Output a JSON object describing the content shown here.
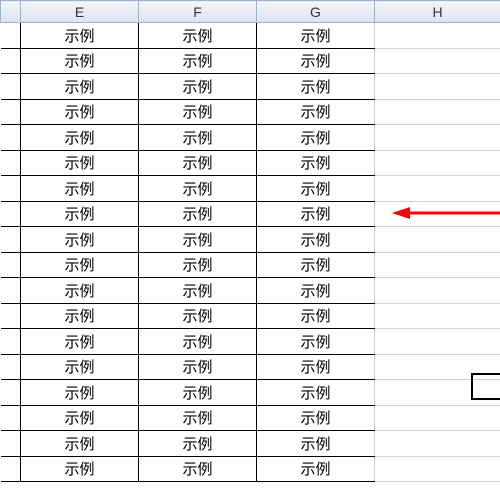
{
  "columns": [
    "E",
    "F",
    "G",
    "H"
  ],
  "cell_value": "示例",
  "rows": 18,
  "arrow_color": "#ff0000",
  "chart_data": {
    "type": "table",
    "columns": [
      "E",
      "F",
      "G",
      "H"
    ],
    "data": [
      [
        "示例",
        "示例",
        "示例",
        ""
      ],
      [
        "示例",
        "示例",
        "示例",
        ""
      ],
      [
        "示例",
        "示例",
        "示例",
        ""
      ],
      [
        "示例",
        "示例",
        "示例",
        ""
      ],
      [
        "示例",
        "示例",
        "示例",
        ""
      ],
      [
        "示例",
        "示例",
        "示例",
        ""
      ],
      [
        "示例",
        "示例",
        "示例",
        ""
      ],
      [
        "示例",
        "示例",
        "示例",
        ""
      ],
      [
        "示例",
        "示例",
        "示例",
        ""
      ],
      [
        "示例",
        "示例",
        "示例",
        ""
      ],
      [
        "示例",
        "示例",
        "示例",
        ""
      ],
      [
        "示例",
        "示例",
        "示例",
        ""
      ],
      [
        "示例",
        "示例",
        "示例",
        ""
      ],
      [
        "示例",
        "示例",
        "示例",
        ""
      ],
      [
        "示例",
        "示例",
        "示例",
        ""
      ],
      [
        "示例",
        "示例",
        "示例",
        ""
      ],
      [
        "示例",
        "示例",
        "示例",
        ""
      ],
      [
        "示例",
        "示例",
        "示例",
        ""
      ]
    ]
  }
}
